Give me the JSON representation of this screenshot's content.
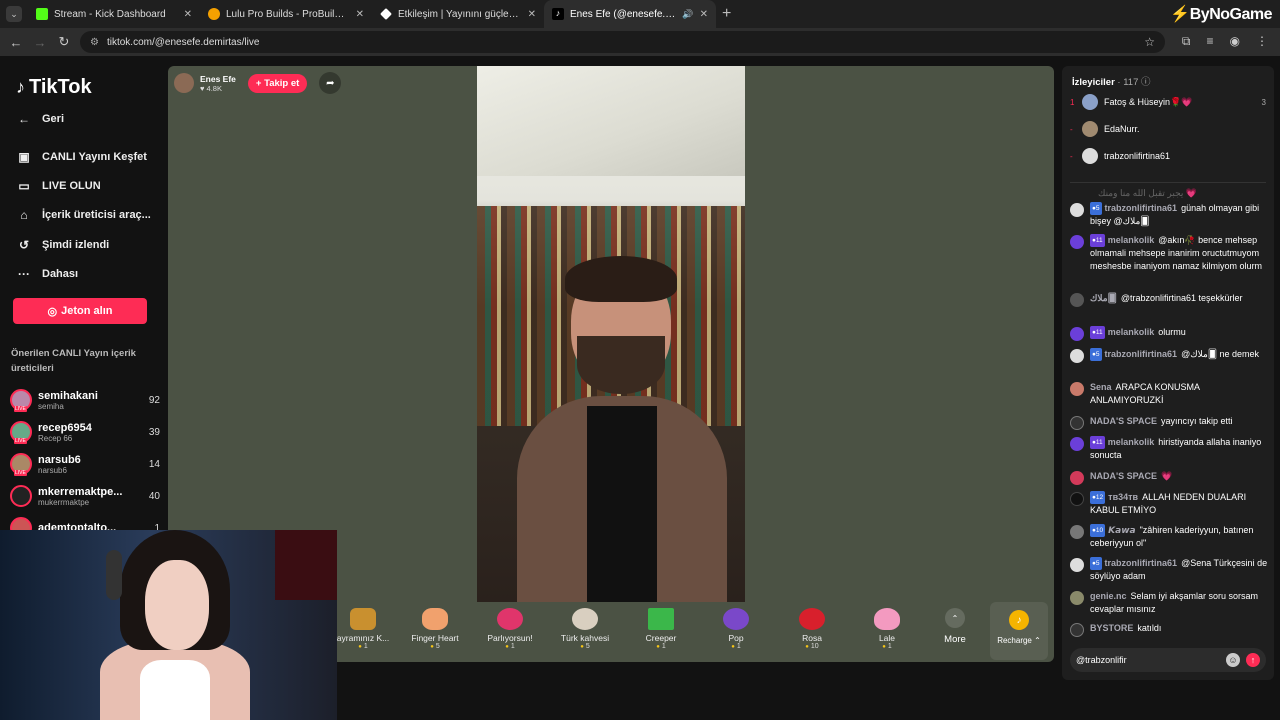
{
  "browser": {
    "tabs": [
      {
        "title": "Stream - Kick Dashboard",
        "color": "#53fc18"
      },
      {
        "title": "Lulu Pro Builds - ProBuilds.net",
        "color": "#f4a000"
      },
      {
        "title": "Etkileşim | Yayınını güçlendirme",
        "color": "#ffffff"
      },
      {
        "title": "Enes Efe (@enesefe.demirtas",
        "color": "#ffffff"
      }
    ],
    "url": "tiktok.com/@enesefe.demirtas/live",
    "brand": "ByNoGame"
  },
  "sidebar": {
    "logo": "TikTok",
    "items": [
      {
        "label": "Geri",
        "icon": "back-arrow-icon"
      },
      {
        "label": "CANLI Yayını Keşfet",
        "icon": "live-tv-icon"
      },
      {
        "label": "LIVE OLUN",
        "icon": "camera-icon"
      },
      {
        "label": "İçerik üreticisi araç...",
        "icon": "creator-tools-icon"
      },
      {
        "label": "Şimdi izlendi",
        "icon": "history-icon"
      },
      {
        "label": "Dahası",
        "icon": "more-dots-icon"
      }
    ],
    "jeton_button": "Jeton alın",
    "suggest_title": "Önerilen CANLI Yayın içerik üreticileri",
    "creators": [
      {
        "name": "semihakani",
        "sub": "semiha",
        "count": "92"
      },
      {
        "name": "recep6954",
        "sub": "Recep 66",
        "count": "39"
      },
      {
        "name": "narsub6",
        "sub": "narsub6",
        "count": "14"
      },
      {
        "name": "mkerremaktpe...",
        "sub": "mukerrmaktpe",
        "count": "40"
      },
      {
        "name": "ademtoptalto...",
        "sub": "",
        "count": "1"
      }
    ]
  },
  "host": {
    "name": "Enes Efe",
    "likes": "♥ 4.8K",
    "follow_label": "+ Takip et"
  },
  "gifts": [
    {
      "name": "ayramınız K...",
      "price": "1"
    },
    {
      "name": "Finger Heart",
      "price": "5"
    },
    {
      "name": "Parlıyorsun!",
      "price": "1"
    },
    {
      "name": "Türk kahvesi",
      "price": "5"
    },
    {
      "name": "Creeper",
      "price": "1"
    },
    {
      "name": "Pop",
      "price": "1"
    },
    {
      "name": "Rosa",
      "price": "10"
    },
    {
      "name": "Lale",
      "price": "1"
    }
  ],
  "gift_more": "More",
  "recharge": "Recharge ⌃",
  "chat": {
    "viewers_label": "İzleyiciler",
    "viewers_count": "· 117",
    "top_viewers": [
      {
        "rank": "1",
        "name": "Fatoş & Hüseyin🌹💗",
        "score": "3"
      },
      {
        "rank": "-",
        "name": "EdaNurr.",
        "score": ""
      },
      {
        "rank": "-",
        "name": "trabzonlifirtina61",
        "score": ""
      }
    ],
    "ghost_text": "يجبر تقبل الله منا ومنك 💗",
    "messages": [
      {
        "badge": "5",
        "user": "trabzonlifirtina61",
        "text": "günah olmayan gibi bişey @ملاك🂠"
      },
      {
        "badge": "11",
        "user": "melankolik",
        "text": "@akın🥀 bence mehsep olmamali mehsepe inanirim oructutmuyom meshesbe inaniyom namaz kilmiyom olurm"
      },
      {
        "badge": "",
        "user": "ملاك🂠",
        "text": "@trabzonlifirtina61 teşekkürler"
      },
      {
        "badge": "11",
        "user": "melankolik",
        "text": "olurmu"
      },
      {
        "badge": "5",
        "user": "trabzonlifirtina61",
        "text": "@ملاك🂠 ne demek"
      },
      {
        "badge": "",
        "user": "Sena",
        "text": "ARAPCA KONUSMA ANLAMIYORUZKİ"
      },
      {
        "badge": "",
        "user": "NADA'S SPACE",
        "text": "yayıncıyı takip etti"
      },
      {
        "badge": "11",
        "user": "melankolik",
        "text": "hiristiyanda allaha inaniyo sonucta"
      },
      {
        "badge": "",
        "user": "NADA'S SPACE",
        "text": "💗"
      },
      {
        "badge": "12",
        "user": "тв34тв",
        "text": "ALLAH NEDEN DUALARI KABUL ETMİYO"
      },
      {
        "badge": "10",
        "user": "𝙆𝙖𝙬𝙖",
        "text": "\"zâhiren kaderiyyun, batınen ceberiyyun ol\""
      },
      {
        "badge": "5",
        "user": "trabzonlifirtina61",
        "text": "@Sena Türkçesini de söylüyo adam"
      },
      {
        "badge": "",
        "user": "genie.nc",
        "text": "Selam iyi akşamlar soru sorsam cevaplar mısınız"
      },
      {
        "badge": "",
        "user": "BYSTORE",
        "text": "katıldı"
      }
    ],
    "input_value": "@trabzonlifir"
  }
}
